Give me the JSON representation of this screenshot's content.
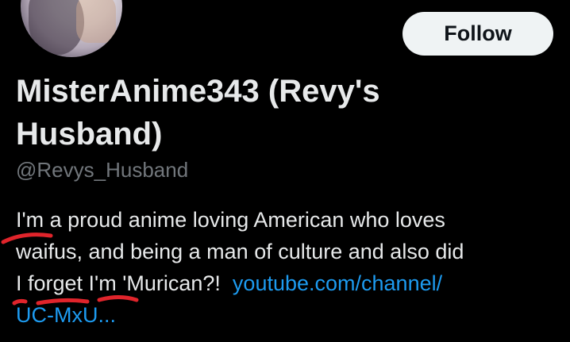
{
  "profile": {
    "display_name_line1": "MisterAnime343 (Revy's",
    "display_name_line2": "Husband)",
    "handle": "@Revys_Husband",
    "follow_label": "Follow",
    "bio": {
      "line1_prefix": "I'm a proud anime loving American who loves",
      "line2": "waifus, and being a man of culture and also did",
      "line3_text": "I forget I'm 'Murican?!",
      "link_part1": "youtube.com/channel/",
      "link_part2": "UC-MxU..."
    }
  },
  "colors": {
    "background": "#000000",
    "text": "#e7e9ea",
    "secondary_text": "#71767b",
    "link": "#1d9bf0",
    "follow_button_bg": "#eff3f4",
    "annotation": "#e0242b"
  }
}
